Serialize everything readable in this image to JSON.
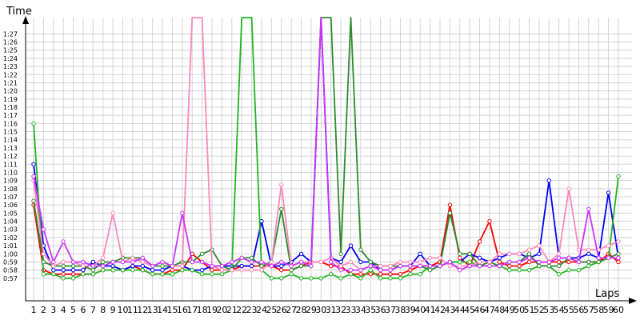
{
  "chart_data": {
    "type": "line",
    "ylabel": "Time",
    "xlabel": "Laps",
    "x": [
      1,
      2,
      3,
      4,
      5,
      6,
      7,
      8,
      9,
      10,
      11,
      12,
      13,
      14,
      15,
      16,
      17,
      18,
      19,
      20,
      21,
      22,
      23,
      24,
      25,
      26,
      27,
      28,
      29,
      30,
      31,
      32,
      33,
      34,
      35,
      36,
      37,
      38,
      39,
      40,
      41,
      42,
      43,
      44,
      45,
      46,
      47,
      48,
      49,
      50,
      51,
      52,
      53,
      54,
      55,
      56,
      57,
      58,
      59,
      60
    ],
    "xlim": [
      1,
      60
    ],
    "ylim": [
      56,
      89
    ],
    "ytick_labels": [
      "0:57",
      "0:58",
      "0:59",
      "1:00",
      "1:01",
      "1:02",
      "1:03",
      "1:04",
      "1:05",
      "1:06",
      "1:07",
      "1:08",
      "1:09",
      "1:10",
      "1:11",
      "1:12",
      "1:13",
      "1:14",
      "1:15",
      "1:16",
      "1:17",
      "1:18",
      "1:19",
      "1:20",
      "1:21",
      "1:22",
      "1:23",
      "1:24",
      "1:25",
      "1:26",
      "1:27"
    ],
    "ytick_values": [
      57,
      58,
      59,
      60,
      61,
      62,
      63,
      64,
      65,
      66,
      67,
      68,
      69,
      70,
      71,
      72,
      73,
      74,
      75,
      76,
      77,
      78,
      79,
      80,
      81,
      82,
      83,
      84,
      85,
      86,
      87
    ],
    "grid": true,
    "series": [
      {
        "color": "#ff0000",
        "values": [
          66,
          58,
          57.5,
          57.5,
          57.5,
          57.5,
          57.5,
          58,
          58,
          58,
          58.5,
          58,
          57.5,
          57.5,
          58,
          58,
          60,
          59,
          58,
          58,
          58,
          58.5,
          58.5,
          58.5,
          58.5,
          58,
          58,
          58.5,
          59,
          59,
          58.5,
          58.5,
          57.5,
          57.5,
          57.5,
          57.5,
          57.5,
          57.5,
          58,
          58.5,
          58.5,
          59,
          66,
          59.5,
          58.5,
          61.5,
          64,
          59,
          58.5,
          58.5,
          59,
          59,
          59,
          59,
          59,
          59,
          59,
          59,
          60,
          59
        ]
      },
      {
        "color": "#0000ff",
        "values": [
          71,
          61,
          58,
          58,
          58,
          58,
          59,
          58.5,
          58.5,
          58,
          58.5,
          58.5,
          58,
          58,
          58.5,
          58.5,
          58,
          58,
          58.5,
          58.5,
          58.5,
          58.5,
          58.5,
          64,
          58.5,
          58.5,
          59,
          60,
          59,
          89,
          59.5,
          59,
          61,
          59,
          59,
          58,
          58,
          58.5,
          58.5,
          60,
          58.5,
          58.5,
          59,
          59,
          60,
          59.5,
          59,
          59.5,
          60,
          60,
          59.5,
          60,
          69,
          59.5,
          59.5,
          59.5,
          60,
          59.5,
          67.5,
          59.5
        ]
      },
      {
        "color": "#22b522",
        "values": [
          76,
          57.5,
          57.5,
          57,
          57,
          57.5,
          57.5,
          58,
          58,
          58,
          58,
          58,
          57.5,
          57.5,
          57.5,
          58,
          58,
          57.5,
          57.5,
          57.5,
          58,
          89,
          89,
          58,
          57,
          57,
          57.5,
          57,
          57,
          57,
          57.5,
          57,
          57.5,
          57,
          58,
          57,
          57,
          57,
          57.5,
          57.5,
          58.5,
          58.5,
          59,
          59,
          59,
          58.5,
          58.5,
          58.5,
          58,
          58,
          58,
          58.5,
          58.5,
          57.5,
          58,
          58,
          58.5,
          59,
          59.5,
          69.5
        ]
      },
      {
        "color": "#2e8b2e",
        "values": [
          66.5,
          59,
          58.5,
          58.5,
          58.5,
          58.5,
          58,
          59,
          59,
          59.5,
          59.5,
          59.5,
          58.5,
          58.5,
          58.5,
          59,
          59,
          60,
          60.5,
          58.5,
          58,
          59.5,
          59.5,
          58.5,
          59,
          65.5,
          58,
          58.5,
          58.5,
          89,
          89,
          60,
          89,
          60.5,
          59,
          58.5,
          58.5,
          58.5,
          58.5,
          58.5,
          58,
          58.5,
          65,
          60,
          60,
          58.5,
          59,
          58.5,
          59,
          59,
          60,
          58.5,
          58.5,
          58.5,
          59.5,
          59,
          59,
          59,
          59.5,
          60
        ]
      },
      {
        "color": "#ff88bb",
        "values": [
          69,
          60,
          58.5,
          59,
          59,
          58.5,
          58.5,
          59.5,
          65,
          59,
          59.5,
          59,
          58.5,
          59,
          58.5,
          58.5,
          89,
          89,
          58.5,
          58,
          58,
          58,
          58,
          58,
          59,
          68.5,
          58.5,
          59,
          59,
          59,
          59.5,
          58.5,
          59,
          58,
          58.5,
          58.5,
          58.5,
          59,
          59,
          59,
          59.5,
          59.5,
          58.5,
          58.5,
          58.5,
          59,
          59,
          60,
          60,
          60,
          60.5,
          61,
          59,
          60,
          68,
          60.5,
          60.5,
          60.5,
          61,
          61.5
        ]
      },
      {
        "color": "#cc33ff",
        "values": [
          69.5,
          63,
          59,
          61.5,
          59,
          59,
          58.5,
          58.5,
          59,
          59,
          59,
          59.5,
          58.5,
          59,
          58.5,
          65,
          59,
          59,
          58.5,
          58.5,
          59,
          59.5,
          59,
          59,
          58.5,
          59,
          58.5,
          59,
          58.5,
          89,
          59,
          58,
          58,
          58,
          58.5,
          58,
          58,
          58.5,
          58.5,
          58.5,
          58.5,
          58.5,
          59,
          58,
          58.5,
          58.5,
          58.5,
          58.5,
          59,
          59,
          59.5,
          59,
          59,
          59.5,
          59.5,
          59,
          65.5,
          59.5,
          59.5,
          59.5
        ]
      }
    ]
  }
}
